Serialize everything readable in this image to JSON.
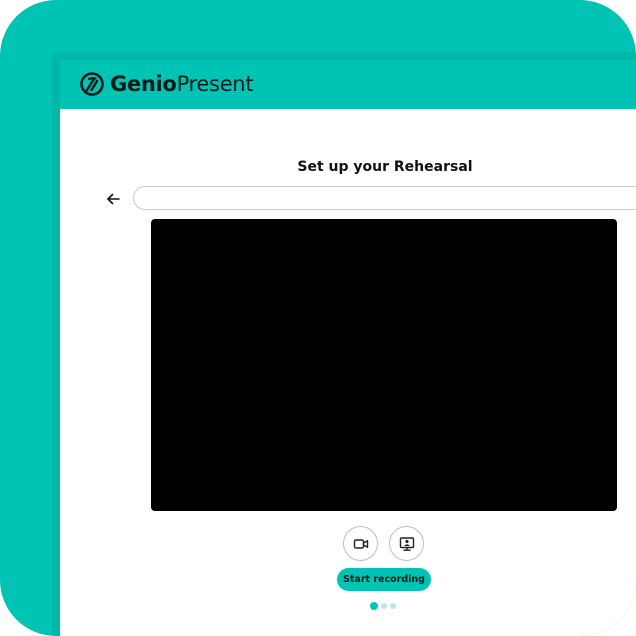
{
  "brand": {
    "name_bold": "Genio",
    "name_regular": "Present",
    "accent_color": "#00c4b3"
  },
  "page": {
    "title": "Set up your Rehearsal"
  },
  "address_bar": {
    "value": "",
    "placeholder": ""
  },
  "controls": {
    "camera_icon": "video-camera-icon",
    "screen_icon": "screen-share-icon",
    "back_icon": "arrow-left-icon",
    "start_label": "Start recording"
  },
  "pagination": {
    "total": 3,
    "active": 1
  }
}
